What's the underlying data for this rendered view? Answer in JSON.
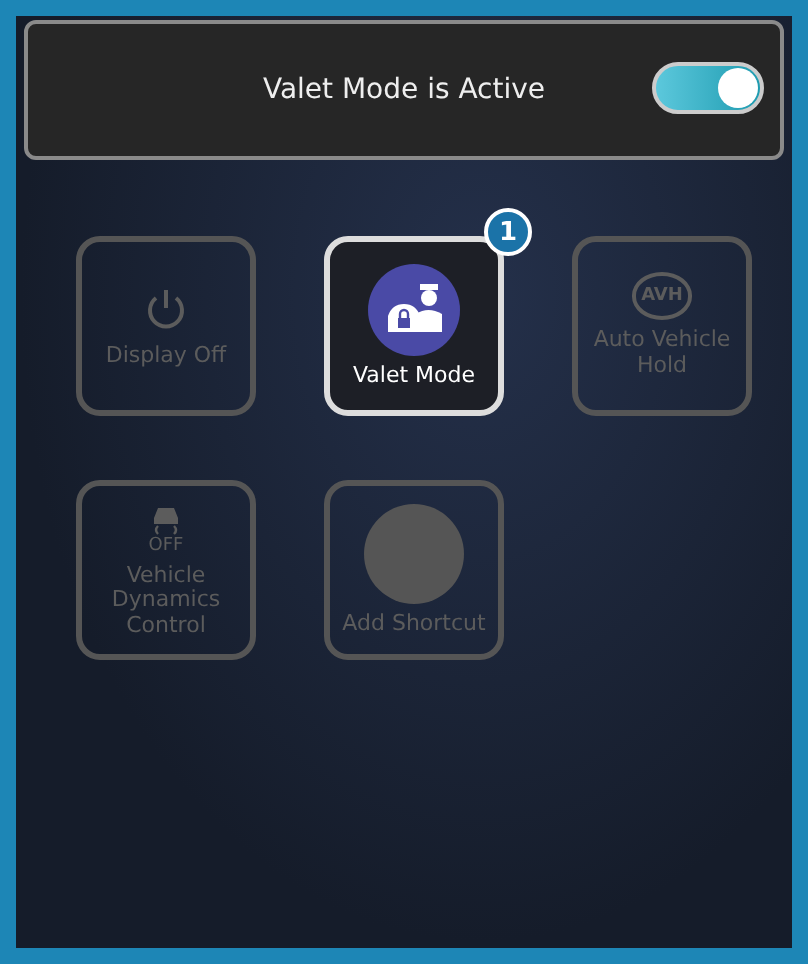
{
  "banner": {
    "text": "Valet Mode is Active",
    "toggle_on": true
  },
  "tiles": [
    {
      "kind": "power",
      "label": "Display Off",
      "disabled": true
    },
    {
      "kind": "valet",
      "label": "Valet Mode",
      "disabled": false,
      "badge": "1"
    },
    {
      "kind": "avh",
      "label": "Auto Vehicle Hold",
      "icon_text": "AVH",
      "disabled": true
    },
    {
      "kind": "vdc",
      "label": "Vehicle Dynamics Control",
      "icon_text": "OFF",
      "disabled": true
    },
    {
      "kind": "add",
      "label": "Add Shortcut",
      "disabled": true
    }
  ]
}
